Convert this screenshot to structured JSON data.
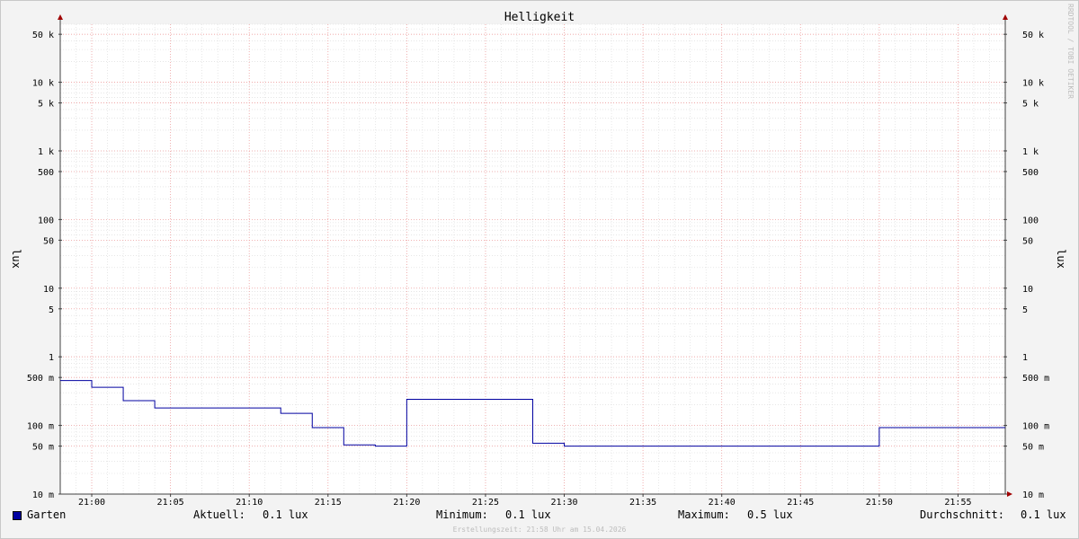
{
  "chart_data": {
    "type": "line",
    "title": "Helligkeit",
    "ylabel": "lux",
    "ylabel_right": "lux",
    "scale": "log",
    "ylim": [
      0.01,
      70000
    ],
    "xlim": [
      "20:58",
      "21:58"
    ],
    "y_ticks": [
      {
        "value": 50000,
        "label": "50 k"
      },
      {
        "value": 10000,
        "label": "10 k"
      },
      {
        "value": 5000,
        "label": "5 k"
      },
      {
        "value": 1000,
        "label": "1 k"
      },
      {
        "value": 500,
        "label": "500"
      },
      {
        "value": 100,
        "label": "100"
      },
      {
        "value": 50,
        "label": "50"
      },
      {
        "value": 10,
        "label": "10"
      },
      {
        "value": 5,
        "label": "5"
      },
      {
        "value": 1,
        "label": "1"
      },
      {
        "value": 0.5,
        "label": "500 m"
      },
      {
        "value": 0.1,
        "label": "100 m"
      },
      {
        "value": 0.05,
        "label": "50 m"
      },
      {
        "value": 0.01,
        "label": "10 m"
      }
    ],
    "x_ticks": [
      "21:00",
      "21:05",
      "21:10",
      "21:15",
      "21:20",
      "21:25",
      "21:30",
      "21:35",
      "21:40",
      "21:45",
      "21:50",
      "21:55"
    ],
    "grid": true,
    "legend": "bottom",
    "series": [
      {
        "name": "Garten",
        "color": "#0000a0",
        "step": true,
        "x": [
          "20:58",
          "21:00",
          "21:02",
          "21:04",
          "21:12",
          "21:14",
          "21:16",
          "21:18",
          "21:20",
          "21:28",
          "21:30",
          "21:50",
          "21:58"
        ],
        "values": [
          0.45,
          0.36,
          0.23,
          0.18,
          0.15,
          0.093,
          0.052,
          0.05,
          0.24,
          0.055,
          0.05,
          0.093,
          0.093
        ]
      }
    ]
  },
  "legend": {
    "series_name": "Garten",
    "current_label": "Aktuell:",
    "current_value": "0.1 lux",
    "min_label": "Minimum:",
    "min_value": "0.1 lux",
    "max_label": "Maximum:",
    "max_value": "0.5 lux",
    "avg_label": "Durchschnitt:",
    "avg_value": "0.1 lux"
  },
  "footer": "Erstellungszeit: 21:58 Uhr am 15.04.2026",
  "watermark": "RRDTOOL / TOBI OETIKER",
  "colors": {
    "background": "#f3f3f3",
    "plot": "#ffffff",
    "minor_grid": "#d8d8d8",
    "major_grid": "#f0a0a0",
    "line": "#0000a0",
    "arrow": "#a00000"
  }
}
